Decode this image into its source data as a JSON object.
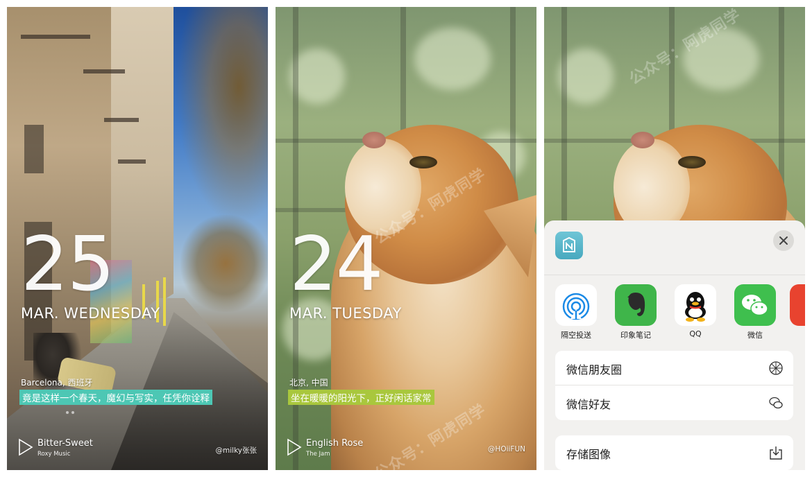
{
  "panels": [
    {
      "day": "25",
      "date_line": "MAR. WEDNESDAY",
      "location": "Barcelona, 西班牙",
      "caption": "竟是这样一个春天，魔幻与写实，任凭你诠释",
      "song_title": "Bitter-Sweet",
      "song_artist": "Roxy Music",
      "credit": "@milky张张",
      "caption_color": "#4dc7b4"
    },
    {
      "day": "24",
      "date_line": "MAR. TUESDAY",
      "location": "北京, 中国",
      "caption": "坐在暖暖的阳光下，正好闲话家常",
      "song_title": "English Rose",
      "song_artist": "The Jam",
      "credit": "@HOiiFUN",
      "caption_color": "#a9c73d"
    }
  ],
  "share_sheet": {
    "apps": [
      {
        "label": "隔空投送",
        "icon": "airdrop-icon",
        "color": "#ffffff"
      },
      {
        "label": "印象笔记",
        "icon": "evernote-icon",
        "color": "#3fb54a"
      },
      {
        "label": "QQ",
        "icon": "qq-icon",
        "color": "#ffffff"
      },
      {
        "label": "微信",
        "icon": "wechat-icon",
        "color": "#3fbf4e"
      }
    ],
    "actions_group1": [
      {
        "label": "微信朋友圈",
        "icon": "moments-icon"
      },
      {
        "label": "微信好友",
        "icon": "wechat-friends-icon"
      }
    ],
    "actions_group2": [
      {
        "label": "存储图像",
        "icon": "save-image-icon"
      }
    ]
  },
  "watermark": "公众号：阿虎同学"
}
